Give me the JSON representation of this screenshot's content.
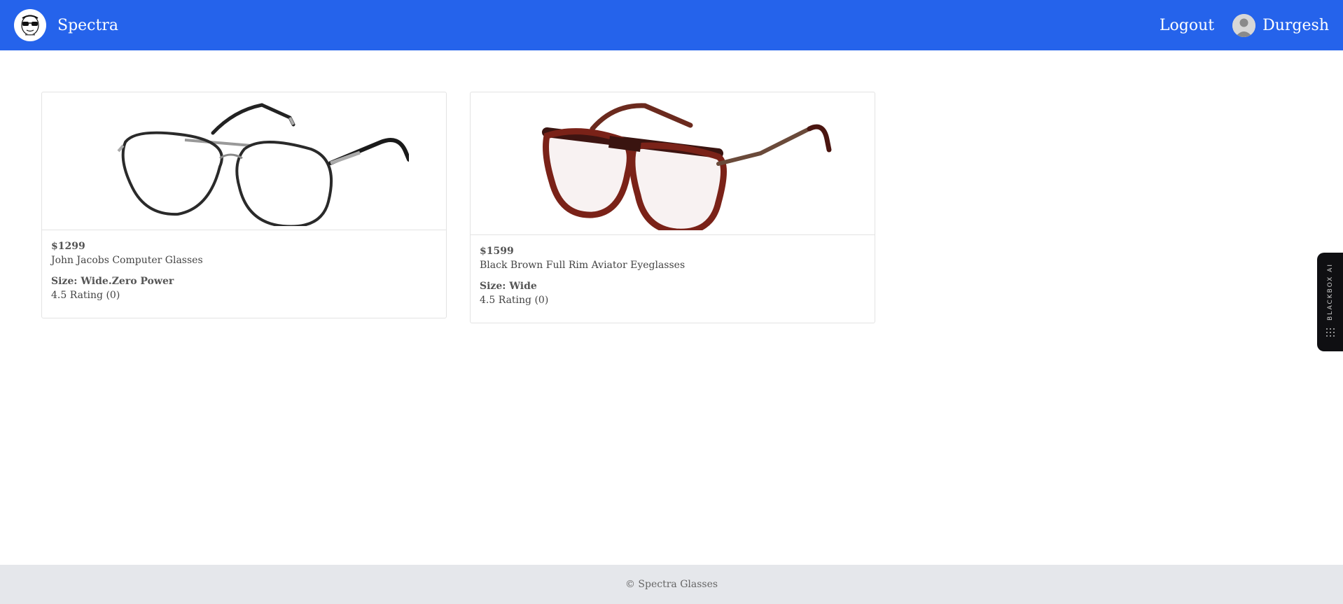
{
  "header": {
    "brand_name": "Spectra",
    "logout_label": "Logout",
    "username": "Durgesh",
    "logo_icon": "sunglasses-face-logo",
    "background_color": "#2563eb"
  },
  "products": [
    {
      "price": "$1299",
      "title": "John Jacobs Computer Glasses",
      "size": "Size: Wide.Zero Power",
      "rating": "4.5 Rating (0)",
      "image_icon": "silver-aviator-glasses"
    },
    {
      "price": "$1599",
      "title": "Black Brown Full Rim Aviator Eyeglasses",
      "size": "Size: Wide",
      "rating": "4.5 Rating (0)",
      "image_icon": "brown-aviator-glasses"
    }
  ],
  "side_widget": {
    "label": "BLACKBOX AI"
  },
  "footer": {
    "text": "© Spectra Glasses",
    "background_color": "#e5e7eb"
  }
}
